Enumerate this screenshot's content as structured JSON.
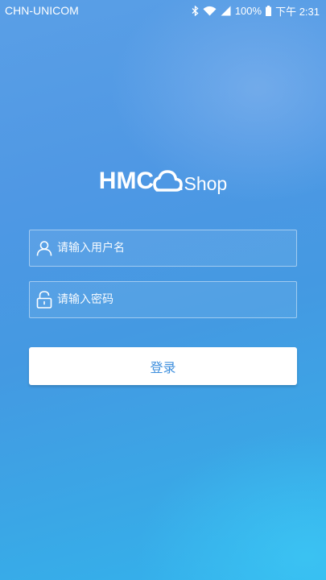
{
  "status_bar": {
    "carrier": "CHN-UNICOM",
    "battery": "100%",
    "time": "下午 2:31",
    "icons": [
      "bluetooth-icon",
      "wifi-icon",
      "signal-icon",
      "battery-icon"
    ]
  },
  "logo": {
    "primary": "HMC",
    "suffix": ".Shop",
    "icon": "cloud-icon"
  },
  "form": {
    "username": {
      "placeholder": "请输入用户名",
      "value": "",
      "icon": "user-icon"
    },
    "password": {
      "placeholder": "请输入密码",
      "value": "",
      "icon": "lock-icon"
    },
    "login_label": "登录"
  },
  "colors": {
    "background_top": "#5a9fe6",
    "background_bottom": "#33b3ec",
    "button_text": "#3f8fdd",
    "button_bg": "#ffffff"
  }
}
